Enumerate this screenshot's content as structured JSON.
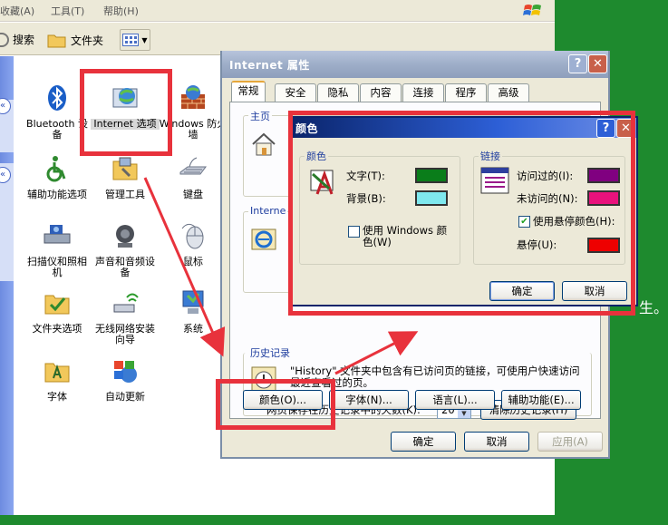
{
  "explorer": {
    "menus": [
      "收藏(A)",
      "工具(T)",
      "帮助(H)"
    ],
    "toolbar": {
      "search_label": "搜索",
      "folders_label": "文件夹"
    },
    "items": [
      {
        "label": "Bluetooth 设备",
        "icon": "bluetooth-icon"
      },
      {
        "label": "Internet 选项",
        "icon": "internet-options-icon"
      },
      {
        "label": "Windows 防火墙",
        "icon": "firewall-icon"
      },
      {
        "label": "辅助功能选项",
        "icon": "accessibility-icon"
      },
      {
        "label": "管理工具",
        "icon": "admin-tools-icon"
      },
      {
        "label": "键盘",
        "icon": "keyboard-icon"
      },
      {
        "label": "扫描仪和照相机",
        "icon": "scanner-icon"
      },
      {
        "label": "声音和音频设备",
        "icon": "speaker-icon"
      },
      {
        "label": "鼠标",
        "icon": "mouse-icon"
      },
      {
        "label": "文件夹选项",
        "icon": "folder-options-icon"
      },
      {
        "label": "无线网络安装向导",
        "icon": "wireless-icon"
      },
      {
        "label": "系统",
        "icon": "system-icon"
      },
      {
        "label": "字体",
        "icon": "fonts-folder-icon"
      },
      {
        "label": "自动更新",
        "icon": "windows-update-icon"
      }
    ]
  },
  "inet": {
    "title": "Internet 属性",
    "tabs": [
      "常规",
      "安全",
      "隐私",
      "内容",
      "连接",
      "程序",
      "高级"
    ],
    "homepage_group": "主页",
    "temp_group": "Interne",
    "history_group": "历史记录",
    "history_text": "\"History\" 文件夹中包含有已访问页的链接，可使用户快速访问最近查看过的页。",
    "days_label": "网页保存在历史记录中的天数(K):",
    "days_value": "20",
    "clear_history": "清除历史记录(H)",
    "bottom_buttons": [
      "颜色(O)...",
      "字体(N)...",
      "语言(L)...",
      "辅助功能(E)..."
    ],
    "ok": "确定",
    "cancel": "取消",
    "apply": "应用(A)"
  },
  "colors": {
    "title": "颜色",
    "color_group": "颜色",
    "text_label": "文字(T):",
    "bg_label": "背景(B):",
    "text_color": "#0a7d1a",
    "bg_color": "#7fe8ee",
    "use_windows_label": "使用 Windows 颜色(W)",
    "use_windows_checked": false,
    "links_group": "链接",
    "visited_label": "访问过的(I):",
    "unvisited_label": "未访问的(N):",
    "visited_color": "#800080",
    "unvisited_color": "#e8127c",
    "hover_label": "使用悬停颜色(H):",
    "hover_checked": true,
    "hover_sub": "悬停(U):",
    "hover_color": "#ee0000",
    "ok": "确定",
    "cancel": "取消"
  },
  "side_text": "生。"
}
